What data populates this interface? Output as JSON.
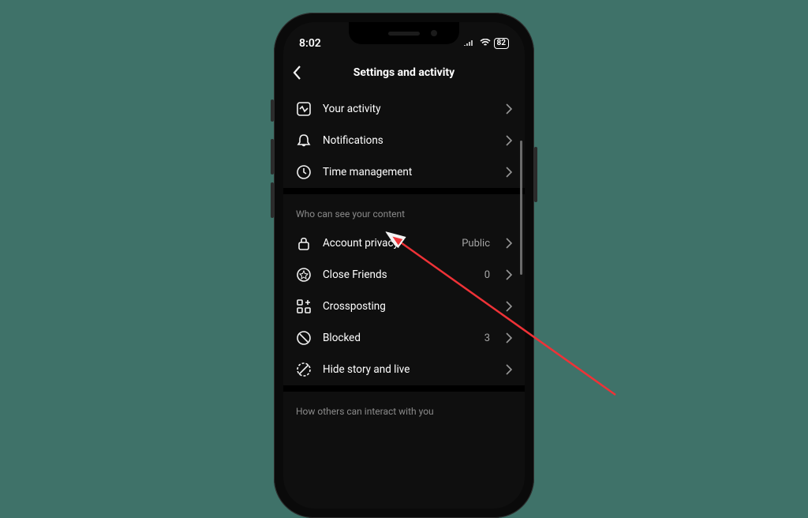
{
  "status": {
    "time": "8:02",
    "battery": "82"
  },
  "header": {
    "title": "Settings and activity"
  },
  "section1": {
    "items": [
      {
        "label": "Your activity"
      },
      {
        "label": "Notifications"
      },
      {
        "label": "Time management"
      }
    ]
  },
  "section2": {
    "heading": "Who can see your content",
    "items": [
      {
        "label": "Account privacy",
        "value": "Public"
      },
      {
        "label": "Close Friends",
        "value": "0"
      },
      {
        "label": "Crossposting"
      },
      {
        "label": "Blocked",
        "value": "3"
      },
      {
        "label": "Hide story and live"
      }
    ]
  },
  "section3": {
    "heading": "How others can interact with you"
  }
}
